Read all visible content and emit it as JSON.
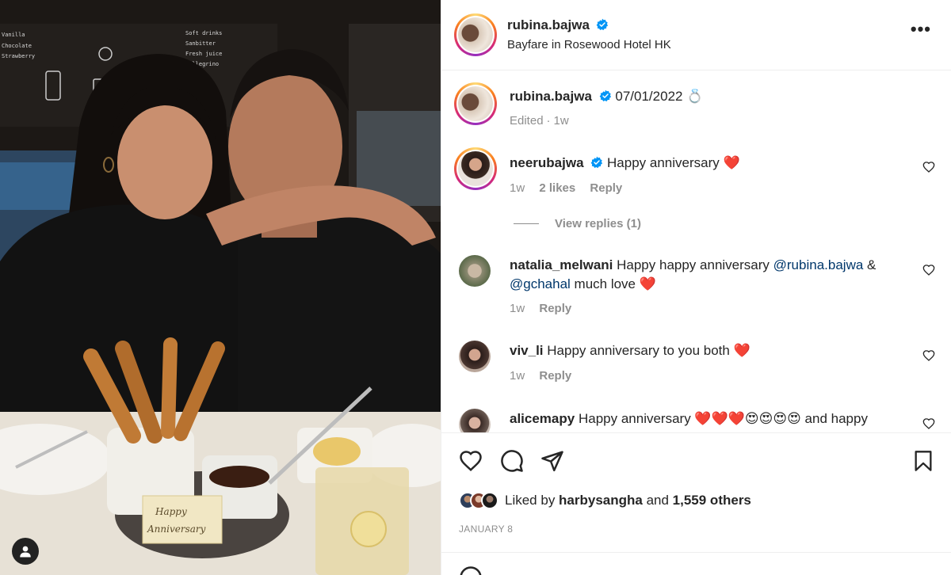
{
  "post": {
    "author": "rubina.bajwa",
    "location": "Bayfare in Rosewood Hotel HK",
    "more_label": "•••"
  },
  "photo": {
    "card_line1": "Happy",
    "card_line2": "Anniversary",
    "menu_lines": [
      "Vanilla",
      "Chocolate",
      "Strawberry",
      "Soft drinks",
      "Sanbitter",
      "Fresh juice",
      "Pellegrino"
    ]
  },
  "caption": {
    "user": "rubina.bajwa",
    "text": "07/01/2022 💍",
    "edited": "Edited",
    "time": "1w"
  },
  "comments": [
    {
      "user": "neerubajwa",
      "text": "Happy anniversary ❤️",
      "time": "1w",
      "likes": "2 likes",
      "reply": "Reply"
    },
    {
      "user": "natalia_melwani",
      "text_before": "Happy happy anniversary ",
      "mention1": "@rubina.bajwa",
      "text_mid": " & ",
      "mention2": "@gchahal",
      "text_after": " much love ❤️",
      "time": "1w",
      "reply": "Reply"
    },
    {
      "user": "viv_li",
      "text": "Happy anniversary to you both ❤️",
      "time": "1w",
      "reply": "Reply"
    },
    {
      "user": "alicemapy",
      "text": "Happy anniversary ❤️❤️❤️😍😍😍😍 and happy"
    }
  ],
  "view_replies": "View replies (1)",
  "likes": {
    "prefix": "Liked by ",
    "user": "harbysangha",
    "mid": " and ",
    "count": "1,559 others"
  },
  "date": "JANUARY 8",
  "colors": {
    "verified": "#0095f6",
    "heart": "#ed4956",
    "mention": "#00376b",
    "muted": "#8e8e8e"
  }
}
